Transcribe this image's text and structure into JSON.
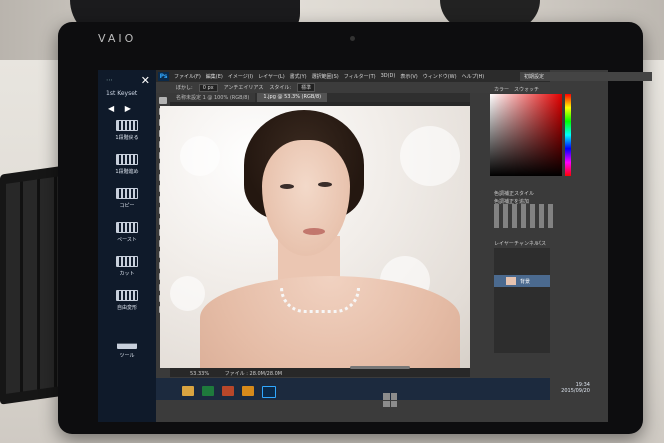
{
  "device": {
    "brand": "VAIO"
  },
  "keyset": {
    "title": "1st Keyset",
    "buttons": [
      {
        "label": "1段階戻る"
      },
      {
        "label": "1段階進め"
      },
      {
        "label": "コピー"
      },
      {
        "label": "ペースト"
      },
      {
        "label": "カット"
      },
      {
        "label": "自由変形"
      },
      {
        "label": "ツール"
      }
    ]
  },
  "photoshop": {
    "logo": "Ps",
    "menus": [
      "ファイル(F)",
      "編集(E)",
      "イメージ(I)",
      "レイヤー(L)",
      "書式(Y)",
      "選択範囲(S)",
      "フィルター(T)",
      "3D(D)",
      "表示(V)",
      "ウィンドウ(W)",
      "ヘルプ(H)"
    ],
    "workspace": "初期設定",
    "options": {
      "blur_label": "ぼかし:",
      "blur_value": "0 px",
      "antialias": "アンチエイリアス",
      "style_label": "スタイル:",
      "style_value": "標準"
    },
    "tabs": [
      {
        "label": "名称未設定 1 @ 100% (RGB/8)",
        "active": false
      },
      {
        "label": "1.jpg @ 53.3% (RGB/8)",
        "active": true
      }
    ],
    "panels": {
      "color_tab": "カラー",
      "swatches_tab": "スウォッチ",
      "adjust_tab": "色調補正",
      "styles_tab": "スタイル",
      "adjust_hint": "色調補正を追加",
      "layers_tab": "レイヤー",
      "channels_tab": "チャンネル",
      "paths_tab": "パス",
      "layer_name": "背景"
    },
    "status": {
      "zoom": "53.33%",
      "file": "ファイル : 28.0M/28.0M"
    }
  },
  "taskbar": {
    "time": "19:34",
    "date": "2015/09/20"
  },
  "colors": {
    "accent": "#31a8ff",
    "selection": "#4b6a8f",
    "keyset_bg": "#0f1a2a"
  }
}
